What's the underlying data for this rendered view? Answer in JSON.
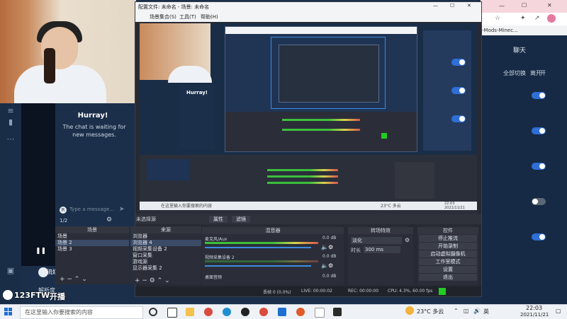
{
  "browser": {
    "tab_title": "-Mods-Minec...",
    "chat_title": "聊天",
    "switch_all": "全部切换",
    "leave": "离开",
    "open": "开"
  },
  "left_chat": {
    "hurray": "Hurray!",
    "sub": "The chat is waiting for new messages.",
    "input_placeholder": "Type a message...",
    "avatar_letter": "R",
    "count": "1/2",
    "section_label": "流媒",
    "analyze": "解析度"
  },
  "obs": {
    "title": "配置文件: 未命名 - 场景: 未命名",
    "menu": [
      "场景集合(S)",
      "工具(T)",
      "帮助(H)"
    ],
    "no_source": "未选择源",
    "props_btn": "属性",
    "filters_btn": "滤镜",
    "docks": {
      "scenes": "场景",
      "sources": "来源",
      "mixer": "混音器",
      "transitions": "转场特效",
      "controls": "控件"
    },
    "scenes": [
      "场景",
      "场景 2",
      "场景 3"
    ],
    "sources": [
      "浏览器",
      "浏览器 4",
      "视频采集设备 2",
      "窗口采集",
      "游戏源",
      "显示器采集 2"
    ],
    "mixer": [
      {
        "name": "麦克风/Aux",
        "db": "0.0 dB"
      },
      {
        "name": "视频采集设备 2",
        "db": "0.0 dB"
      },
      {
        "name": "桌面音频",
        "db": "0.0 dB"
      }
    ],
    "transition": {
      "type": "淡化",
      "duration_label": "时长",
      "duration": "300 ms"
    },
    "controls": [
      "停止推流",
      "开始录制",
      "启动虚拟摄像机",
      "工作室模式",
      "设置",
      "退出"
    ],
    "status": {
      "dropped": "丢帧 0 (0.0%)",
      "live": "LIVE: 00:00:02",
      "rec": "REC: 00:00:00",
      "cpu": "CPU: 4.3%, 60.00 fps"
    }
  },
  "nested_taskbar": {
    "search": "在这里输入你要搜索的内容",
    "weather": "23°C 多云",
    "time": "22:03",
    "date": "2021/11/21"
  },
  "taskbar": {
    "search": "在这里输入你要搜索的内容",
    "weather": "23°C 多云",
    "ime": "英",
    "time": "22:03",
    "date": "2021/11/21"
  },
  "watermark": {
    "text": "123FTW",
    "suffix": "开播"
  },
  "colors": {
    "accent": "#2f6fd6",
    "obs_bg": "#272a33",
    "chat_bg": "#1b2f4a"
  }
}
